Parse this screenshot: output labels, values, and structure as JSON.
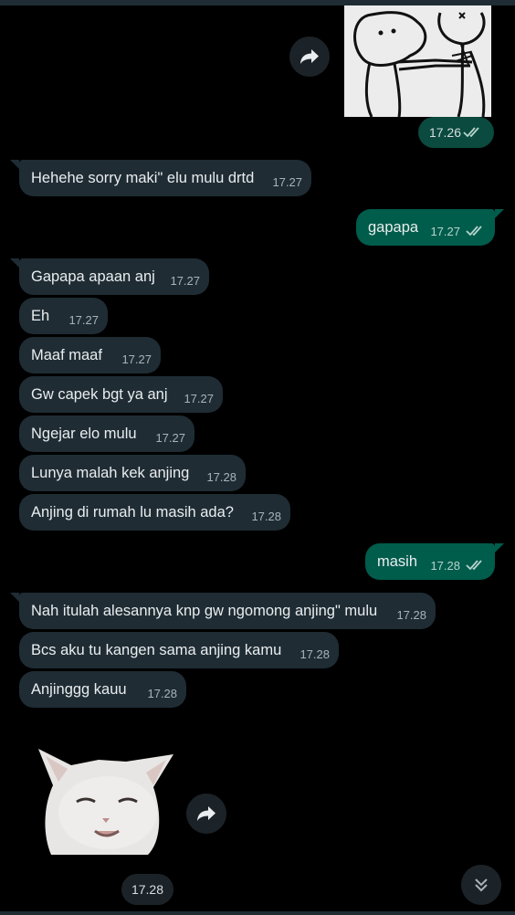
{
  "messages": [
    {
      "text": "",
      "time": "17.26"
    },
    {
      "text": "Hehehe sorry maki\" elu mulu drtd",
      "time": "17.27"
    },
    {
      "text": "gapapa",
      "time": "17.27"
    },
    {
      "text": "Gapapa apaan anj",
      "time": "17.27"
    },
    {
      "text": "Eh",
      "time": "17.27"
    },
    {
      "text": "Maaf maaf",
      "time": "17.27"
    },
    {
      "text": "Gw capek bgt ya anj",
      "time": "17.27"
    },
    {
      "text": "Ngejar elo mulu",
      "time": "17.27"
    },
    {
      "text": "Lunya malah kek anjing",
      "time": "17.28"
    },
    {
      "text": "Anjing di rumah lu masih ada?",
      "time": "17.28"
    },
    {
      "text": "masih",
      "time": "17.28"
    },
    {
      "text": "Nah itulah alesannya knp gw ngomong anjing\" mulu",
      "time": "17.28"
    },
    {
      "text": "Bcs aku tu kangen sama anjing kamu",
      "time": "17.28"
    },
    {
      "text": "Anjinggg kauu",
      "time": "17.28"
    },
    {
      "text": "",
      "time": "17.28"
    }
  ],
  "icons": {
    "forward": "forward-arrow-icon",
    "read": "double-check-icon",
    "scroll": "chevrons-down-icon"
  },
  "colors": {
    "background": "#000000",
    "incoming_bubble": "#1f2c34",
    "outgoing_bubble": "#005c4b",
    "read_ticks": "#b6d4cd"
  }
}
